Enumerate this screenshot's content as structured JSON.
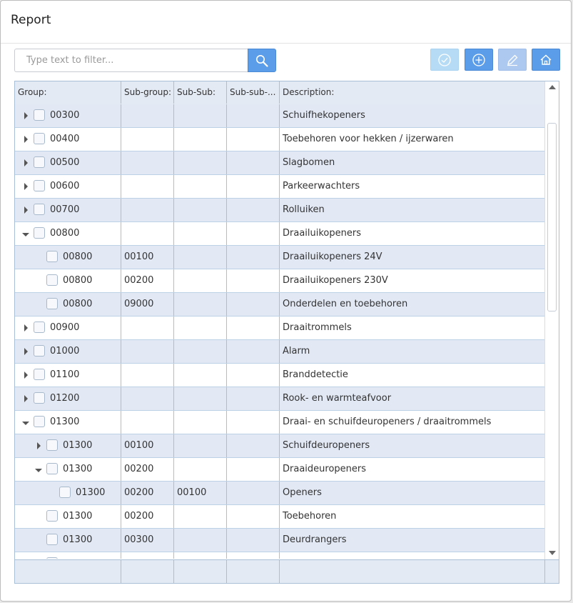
{
  "dialog": {
    "title": "Report"
  },
  "filter": {
    "placeholder": "Type text to filter...",
    "value": ""
  },
  "toolbar": [
    {
      "name": "confirm-button",
      "icon": "check-circle-icon",
      "state": "disabled"
    },
    {
      "name": "add-button",
      "icon": "plus-circle-icon",
      "state": "enabled"
    },
    {
      "name": "edit-button",
      "icon": "pencil-icon",
      "state": "disabled"
    },
    {
      "name": "home-button",
      "icon": "home-icon",
      "state": "enabled"
    }
  ],
  "grid": {
    "columns": [
      "Group:",
      "Sub-group:",
      "Sub-Sub:",
      "Sub-sub-...",
      "Description:"
    ],
    "rows": [
      {
        "level": 0,
        "toggle": "collapsed",
        "group": "00300",
        "sub": "",
        "subsub": "",
        "subsubsub": "",
        "desc": "Schuifhekopeners"
      },
      {
        "level": 0,
        "toggle": "collapsed",
        "group": "00400",
        "sub": "",
        "subsub": "",
        "subsubsub": "",
        "desc": "Toebehoren voor hekken / ijzerwaren"
      },
      {
        "level": 0,
        "toggle": "collapsed",
        "group": "00500",
        "sub": "",
        "subsub": "",
        "subsubsub": "",
        "desc": "Slagbomen"
      },
      {
        "level": 0,
        "toggle": "collapsed",
        "group": "00600",
        "sub": "",
        "subsub": "",
        "subsubsub": "",
        "desc": "Parkeerwachters"
      },
      {
        "level": 0,
        "toggle": "collapsed",
        "group": "00700",
        "sub": "",
        "subsub": "",
        "subsubsub": "",
        "desc": "Rolluiken"
      },
      {
        "level": 0,
        "toggle": "expanded",
        "group": "00800",
        "sub": "",
        "subsub": "",
        "subsubsub": "",
        "desc": "Draailuikopeners"
      },
      {
        "level": 1,
        "toggle": "none",
        "group": "00800",
        "sub": "00100",
        "subsub": "",
        "subsubsub": "",
        "desc": "Draailuikopeners 24V"
      },
      {
        "level": 1,
        "toggle": "none",
        "group": "00800",
        "sub": "00200",
        "subsub": "",
        "subsubsub": "",
        "desc": "Draailuikopeners 230V"
      },
      {
        "level": 1,
        "toggle": "none",
        "group": "00800",
        "sub": "09000",
        "subsub": "",
        "subsubsub": "",
        "desc": "Onderdelen en toebehoren"
      },
      {
        "level": 0,
        "toggle": "collapsed",
        "group": "00900",
        "sub": "",
        "subsub": "",
        "subsubsub": "",
        "desc": "Draaitrommels"
      },
      {
        "level": 0,
        "toggle": "collapsed",
        "group": "01000",
        "sub": "",
        "subsub": "",
        "subsubsub": "",
        "desc": "Alarm"
      },
      {
        "level": 0,
        "toggle": "collapsed",
        "group": "01100",
        "sub": "",
        "subsub": "",
        "subsubsub": "",
        "desc": "Branddetectie"
      },
      {
        "level": 0,
        "toggle": "collapsed",
        "group": "01200",
        "sub": "",
        "subsub": "",
        "subsubsub": "",
        "desc": "Rook- en warmteafvoor"
      },
      {
        "level": 0,
        "toggle": "expanded",
        "group": "01300",
        "sub": "",
        "subsub": "",
        "subsubsub": "",
        "desc": "Draai- en schuifdeuropeners / draaitrommels"
      },
      {
        "level": 1,
        "toggle": "collapsed",
        "group": "01300",
        "sub": "00100",
        "subsub": "",
        "subsubsub": "",
        "desc": "Schuifdeuropeners"
      },
      {
        "level": 1,
        "toggle": "expanded",
        "group": "01300",
        "sub": "00200",
        "subsub": "",
        "subsubsub": "",
        "desc": "Draaideuropeners"
      },
      {
        "level": 2,
        "toggle": "none",
        "group": "01300",
        "sub": "00200",
        "subsub": "00100",
        "subsubsub": "",
        "desc": "Openers"
      },
      {
        "level": 1,
        "toggle": "none",
        "group": "01300",
        "sub": "00200",
        "subsub": "",
        "subsubsub": "",
        "desc": "Toebehoren"
      },
      {
        "level": 1,
        "toggle": "none",
        "group": "01300",
        "sub": "00300",
        "subsub": "",
        "subsubsub": "",
        "desc": "Deurdrangers"
      },
      {
        "level": 1,
        "toggle": "none",
        "group": "01300",
        "sub": "00300",
        "subsub": "",
        "subsubsub": "",
        "desc": ""
      }
    ]
  },
  "colors": {
    "accent": "#5b9de8",
    "row_alt": "#e2e9f5",
    "header": "#e4eaf4",
    "border": "#a9bfd8"
  }
}
